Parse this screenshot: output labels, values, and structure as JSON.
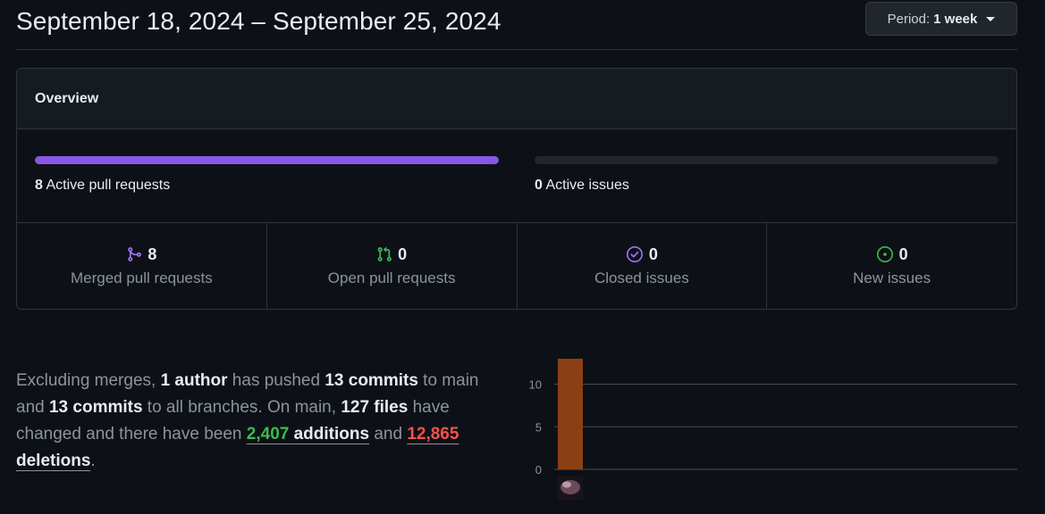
{
  "header": {
    "date_range": "September 18, 2024 – September 25, 2024",
    "period_label": "Period:",
    "period_value": "1 week"
  },
  "overview": {
    "title": "Overview",
    "active_pull_requests": {
      "count": "8",
      "label": "Active pull requests",
      "fill_fraction": 1.0
    },
    "active_issues": {
      "count": "0",
      "label": "Active issues",
      "fill_fraction": 0.0
    },
    "stats": [
      {
        "icon": "merged-pr-icon",
        "value": "8",
        "label": "Merged pull requests",
        "color": "#a371f7"
      },
      {
        "icon": "open-pr-icon",
        "value": "0",
        "label": "Open pull requests",
        "color": "#3fb950"
      },
      {
        "icon": "closed-issue-icon",
        "value": "0",
        "label": "Closed issues",
        "color": "#a371f7"
      },
      {
        "icon": "new-issue-icon",
        "value": "0",
        "label": "New issues",
        "color": "#3fb950"
      }
    ]
  },
  "summary": {
    "p1": "Excluding merges, ",
    "authors": "1 author",
    "p2": " has pushed ",
    "commits_main": "13 commits",
    "p3": " to main and ",
    "commits_all": "13 commits",
    "p4": " to all branches. On main, ",
    "files": "127 files",
    "p5": " have changed and there have been ",
    "additions_num": "2,407",
    "additions_word": "additions",
    "p6": " and ",
    "deletions_num": "12,865",
    "deletions_word": "deletions",
    "p7": "."
  },
  "chart_data": {
    "type": "bar",
    "categories": [
      "author-avatar"
    ],
    "values": [
      13
    ],
    "ylim": [
      0,
      13
    ],
    "yticks": [
      "0",
      "5",
      "10"
    ],
    "bar_color": "#8b3f14",
    "grid": true
  }
}
